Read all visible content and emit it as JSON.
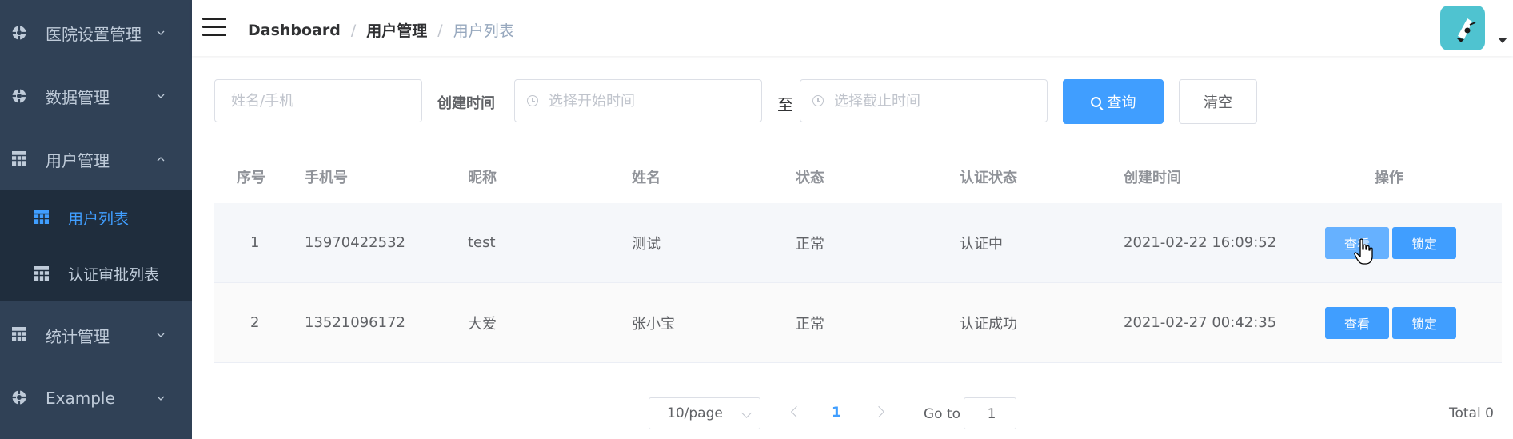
{
  "sidebar": {
    "items": [
      {
        "label": "医院设置管理",
        "icon": "component-icon",
        "expanded": false
      },
      {
        "label": "数据管理",
        "icon": "component-icon",
        "expanded": false
      },
      {
        "label": "用户管理",
        "icon": "table-icon",
        "expanded": true
      },
      {
        "label": "统计管理",
        "icon": "table-icon",
        "expanded": false
      },
      {
        "label": "Example",
        "icon": "component-icon",
        "expanded": false
      }
    ],
    "subitems": [
      {
        "label": "用户列表",
        "icon": "table-icon",
        "active": true
      },
      {
        "label": "认证审批列表",
        "icon": "table-icon",
        "active": false
      }
    ]
  },
  "navbar": {
    "breadcrumb": [
      "Dashboard",
      "用户管理",
      "用户列表"
    ]
  },
  "search": {
    "name_placeholder": "姓名/手机",
    "created_label": "创建时间",
    "start_placeholder": "选择开始时间",
    "to_label": "至",
    "end_placeholder": "选择截止时间",
    "search_button": "查询",
    "clear_button": "清空"
  },
  "table": {
    "headers": [
      "序号",
      "手机号",
      "昵称",
      "姓名",
      "状态",
      "认证状态",
      "创建时间",
      "操作"
    ],
    "rows": [
      {
        "index": "1",
        "phone": "15970422532",
        "nickname": "test",
        "name": "测试",
        "status": "正常",
        "auth_status": "认证中",
        "created": "2021-02-22 16:09:52",
        "view": "查看",
        "lock": "锁定"
      },
      {
        "index": "2",
        "phone": "13521096172",
        "nickname": "大爱",
        "name": "张小宝",
        "status": "正常",
        "auth_status": "认证成功",
        "created": "2021-02-27 00:42:35",
        "view": "查看",
        "lock": "锁定"
      }
    ]
  },
  "pagination": {
    "page_size": "10/page",
    "current_page": "1",
    "goto_label": "Go to",
    "goto_value": "1",
    "total": "Total 0"
  },
  "colors": {
    "sidebar_bg": "#304156",
    "submenu_bg": "#1f2d3d",
    "primary": "#409eff",
    "avatar_bg": "#4fc3d0"
  }
}
